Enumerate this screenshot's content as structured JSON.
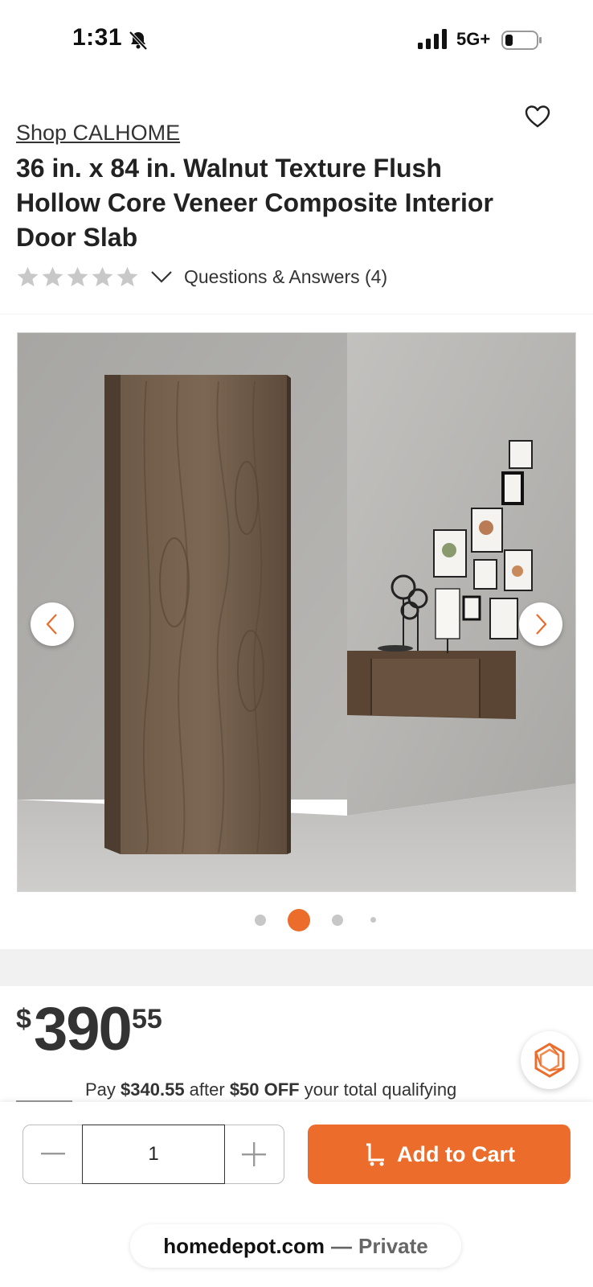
{
  "status_bar": {
    "time": "1:31",
    "network": "5G+",
    "icons": [
      "bell-off-icon",
      "signal-icon",
      "battery-icon"
    ]
  },
  "product": {
    "brand_link": "Shop CALHOME",
    "title": "36 in. x 84 in. Walnut Texture Flush Hollow Core Veneer Composite Interior Door Slab",
    "rating_stars": 0,
    "qa_link": "Questions & Answers (4)"
  },
  "gallery": {
    "image_alt": "Walnut texture door slab",
    "image_count": 4,
    "active_index": 1
  },
  "price": {
    "symbol": "$",
    "dollars": "390",
    "cents": "55"
  },
  "promo": {
    "prefix": "Pay ",
    "pay_amount": "$340.55",
    "middle": " after ",
    "discount": "$50 OFF",
    "suffix": " your total qualifying"
  },
  "cart": {
    "quantity": "1",
    "add_label": "Add to Cart"
  },
  "browser": {
    "domain": "homedepot.com",
    "separator": "—",
    "mode": "Private"
  },
  "colors": {
    "accent": "#ec6c2b",
    "star_gray": "#c8c8c8"
  }
}
